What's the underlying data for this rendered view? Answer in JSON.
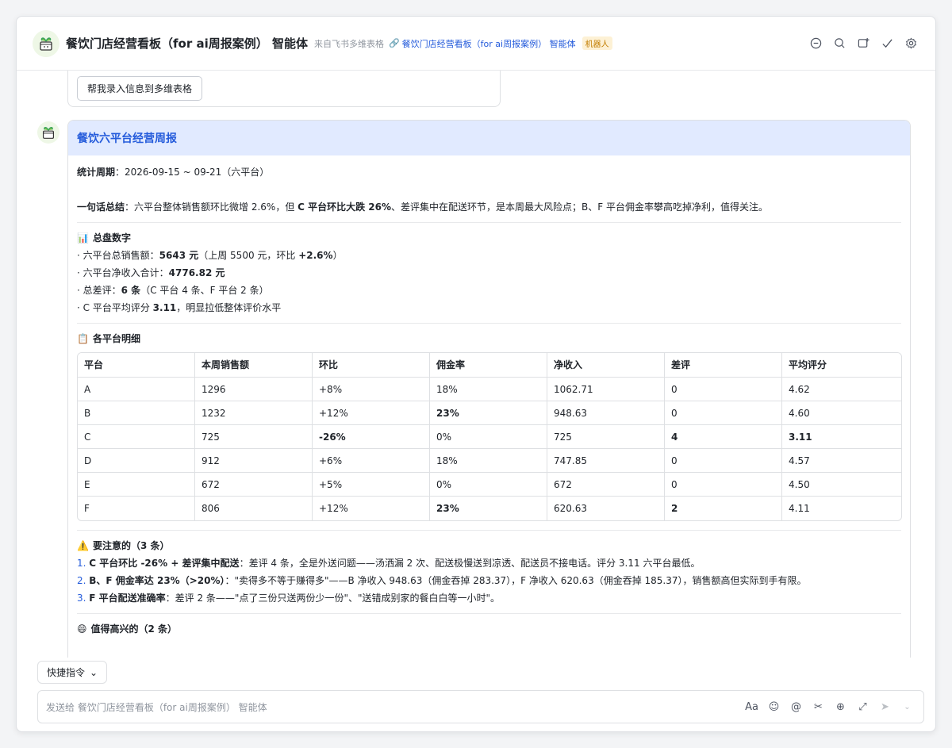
{
  "header": {
    "title": "餐饮门店经营看板（for ai周报案例） 智能体",
    "from": "来自飞书多维表格",
    "link": "餐饮门店经营看板（for ai周报案例） 智能体",
    "badge": "机器人",
    "icons": [
      "chat-bubble-icon",
      "search-icon",
      "add-window-icon",
      "check-icon",
      "gear-icon"
    ]
  },
  "previous": {
    "button": "帮我录入信息到多维表格"
  },
  "report": {
    "title": "餐饮六平台经营周报",
    "period_label": "统计周期",
    "period_value": "：2026-09-15 ~ 09-21（六平台）",
    "summary_label": "一句话总结",
    "summary_a": "：六平台整体销售额环比微增 2.6%，但 ",
    "summary_b": "C 平台环比大跌 26%",
    "summary_c": "、差评集中在配送环节，是本周最大风险点；B、F 平台佣金率攀高吃掉净利，值得关注。",
    "overview_title": "总盘数字",
    "o1a": "六平台总销售额：",
    "o1b": "5643 元",
    "o1c": "（上周 5500 元，环比 ",
    "o1d": "+2.6%",
    "o1e": "）",
    "o2a": "六平台净收入合计：",
    "o2b": "4776.82 元",
    "o3a": "总差评：",
    "o3b": "6 条",
    "o3c": "（C 平台 4 条、F 平台 2 条）",
    "o4a": "C 平台平均评分 ",
    "o4b": "3.11",
    "o4c": "，明显拉低整体评价水平",
    "detail_title": "各平台明细",
    "table": {
      "headers": [
        "平台",
        "本周销售额",
        "环比",
        "佣金率",
        "净收入",
        "差评",
        "平均评分"
      ],
      "rows": [
        [
          "A",
          "1296",
          "+8%",
          "18%",
          "1062.71",
          "0",
          "4.62"
        ],
        [
          "B",
          "1232",
          "+12%",
          "23%",
          "948.63",
          "0",
          "4.60"
        ],
        [
          "C",
          "725",
          "-26%",
          "0%",
          "725",
          "4",
          "3.11"
        ],
        [
          "D",
          "912",
          "+6%",
          "18%",
          "747.85",
          "0",
          "4.57"
        ],
        [
          "E",
          "672",
          "+5%",
          "0%",
          "672",
          "0",
          "4.50"
        ],
        [
          "F",
          "806",
          "+12%",
          "23%",
          "620.63",
          "2",
          "4.11"
        ]
      ]
    },
    "warn_title": "要注意的（3 条）",
    "w1n": "1.",
    "w1a": "C 平台环比 -26% + 差评集中配送",
    "w1b": "：差评 4 条，全是外送问题——汤洒漏 2 次、配送极慢送到凉透、配送员不接电话。评分 3.11 六平台最低。",
    "w2n": "2.",
    "w2a": "B、F 佣金率达 23%（>20%）",
    "w2b": "：\"卖得多不等于赚得多\"——B 净收入 948.63（佣金吞掉 283.37），F 净收入 620.63（佣金吞掉 185.37），销售额高但实际到手有限。",
    "w3n": "3.",
    "w3a": "F 平台配送准确率",
    "w3b": "：差评 2 条——\"点了三份只送两份少一份\"、\"送错成别家的餐白白等一小时\"。",
    "happy_title": "值得高兴的（2 条）"
  },
  "footer": {
    "quick": "快捷指令",
    "placeholder": "发送给 餐饮门店经营看板（for ai周报案例） 智能体",
    "icons": [
      "font-icon",
      "emoji-icon",
      "mention-icon",
      "scissors-icon",
      "plus-circle-icon",
      "expand-icon",
      "send-icon"
    ]
  },
  "colors": {
    "accent": "#245bdb",
    "card_header": "#e1eaff",
    "badge_bg": "#fdf1d5"
  }
}
